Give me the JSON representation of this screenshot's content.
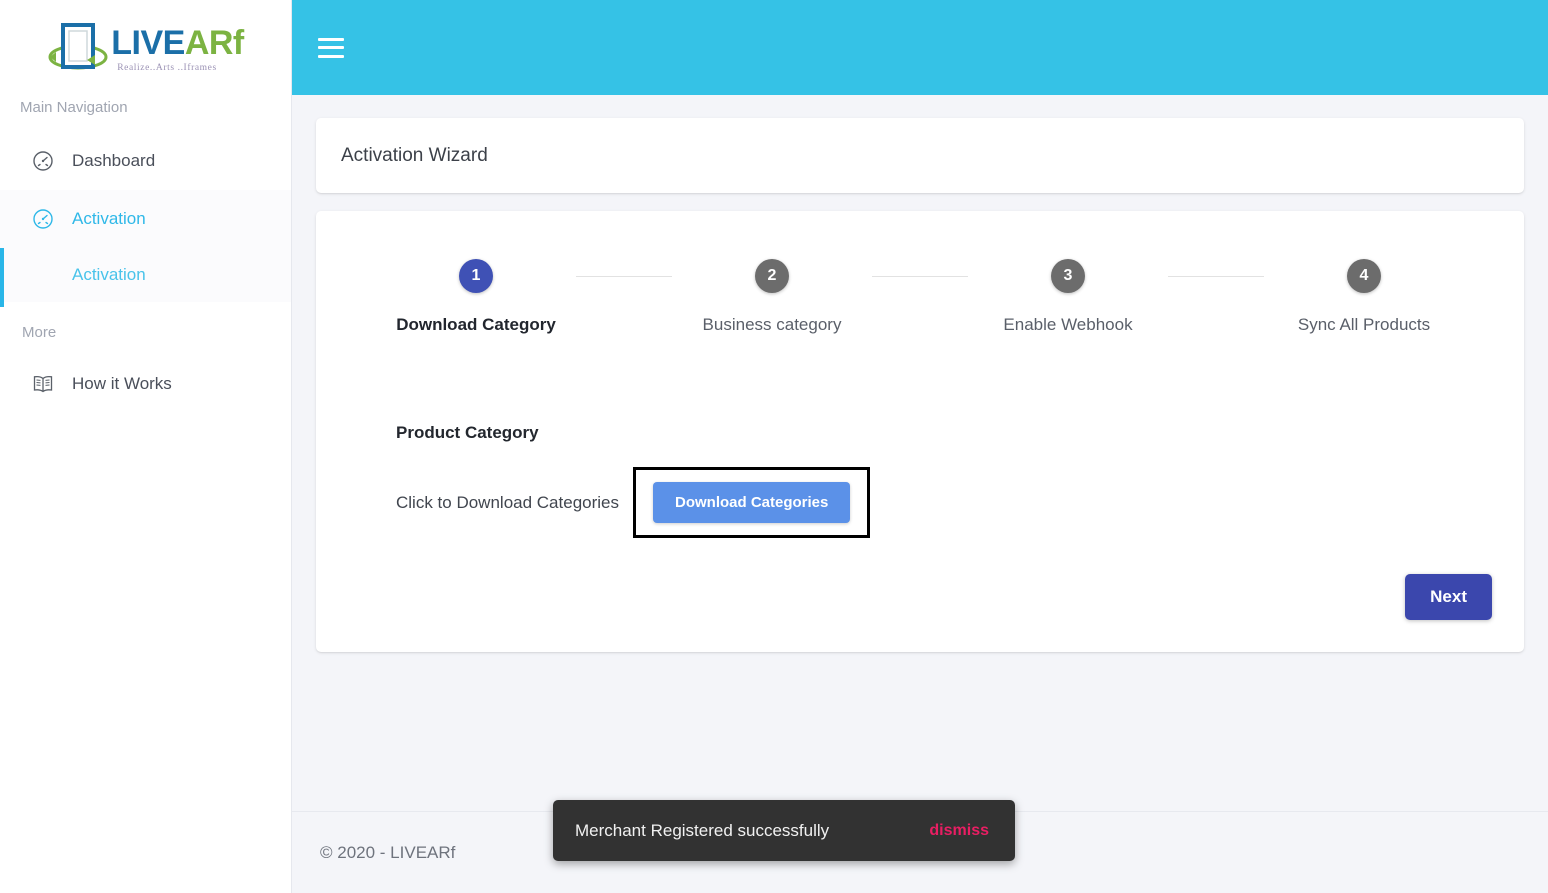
{
  "brand": {
    "logo_live": "LIVE",
    "logo_ar": "AR",
    "logo_f": "f",
    "tagline": "Realize..Arts ..Iframes"
  },
  "sidebar": {
    "heading_main": "Main Navigation",
    "heading_more": "More",
    "items": [
      {
        "label": "Dashboard",
        "icon": "gauge-icon",
        "active": false
      },
      {
        "label": "Activation",
        "icon": "gauge-icon",
        "active": true
      }
    ],
    "subitems": [
      {
        "label": "Activation"
      }
    ],
    "more_items": [
      {
        "label": "How it Works",
        "icon": "book-icon"
      }
    ]
  },
  "topbar": {
    "menu_icon": "hamburger-icon"
  },
  "page": {
    "title": "Activation Wizard"
  },
  "stepper": {
    "steps": [
      {
        "number": "1",
        "label": "Download Category",
        "active": true
      },
      {
        "number": "2",
        "label": "Business category",
        "active": false
      },
      {
        "number": "3",
        "label": "Enable Webhook",
        "active": false
      },
      {
        "number": "4",
        "label": "Sync All Products",
        "active": false
      }
    ]
  },
  "form": {
    "section_title": "Product Category",
    "row_label": "Click to Download Categories",
    "download_button": "Download Categories",
    "next_button": "Next"
  },
  "footer": {
    "copyright": "© 2020 - LIVEARf"
  },
  "snackbar": {
    "message": "Merchant Registered successfully",
    "action": "dismiss"
  },
  "colors": {
    "topbar": "#35c2e6",
    "accent_cyan": "#29b6e8",
    "step_active": "#3f51b5",
    "step_inactive": "#6c6c6c",
    "download_button": "#5b91e8",
    "next_button": "#3b47ad",
    "snackbar_bg": "#323232",
    "snackbar_action": "#e91e63",
    "page_bg": "#f4f5f9"
  }
}
